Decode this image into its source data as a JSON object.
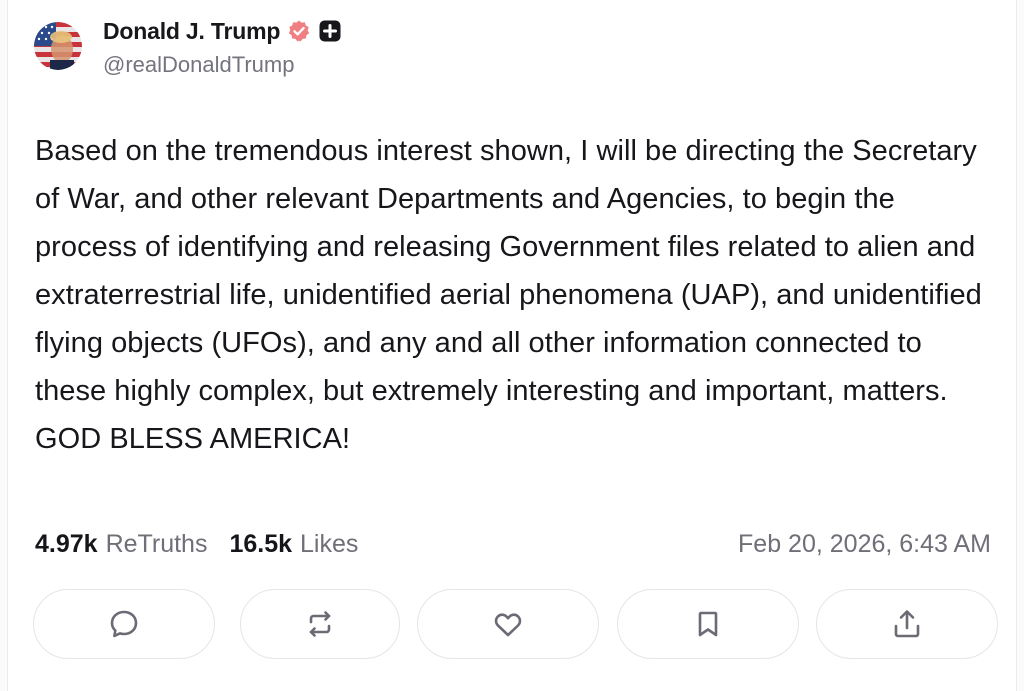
{
  "author": {
    "display_name": "Donald J. Trump",
    "handle": "@realDonaldTrump",
    "avatar_icon": "flag-portrait-avatar",
    "verified_icon": "verified-badge-icon",
    "verified_color": "#f07f84",
    "plus_icon": "plus-badge-icon"
  },
  "post": {
    "text": "Based on the tremendous interest shown, I will be directing the Secretary of War, and other relevant Departments and Agencies, to begin the process of identifying and releasing Government files related to alien and extraterrestrial life, unidentified aerial phenomena (UAP), and unidentified flying objects (UFOs), and any and all other information connected to these highly complex, but extremely interesting and important, matters. GOD BLESS AMERICA!"
  },
  "stats": {
    "retruths_count": "4.97k",
    "retruths_label": "ReTruths",
    "likes_count": "16.5k",
    "likes_label": "Likes",
    "timestamp": "Feb 20, 2026, 6:43 AM"
  },
  "actions": [
    {
      "name": "reply",
      "icon": "comment-icon"
    },
    {
      "name": "retruth",
      "icon": "repost-icon"
    },
    {
      "name": "like",
      "icon": "heart-icon"
    },
    {
      "name": "bookmark",
      "icon": "bookmark-icon"
    },
    {
      "name": "share",
      "icon": "share-icon"
    }
  ],
  "colors": {
    "text": "#16161b",
    "muted": "#6f6f78",
    "border": "#e5e5ea",
    "icon": "#6b6b75"
  }
}
